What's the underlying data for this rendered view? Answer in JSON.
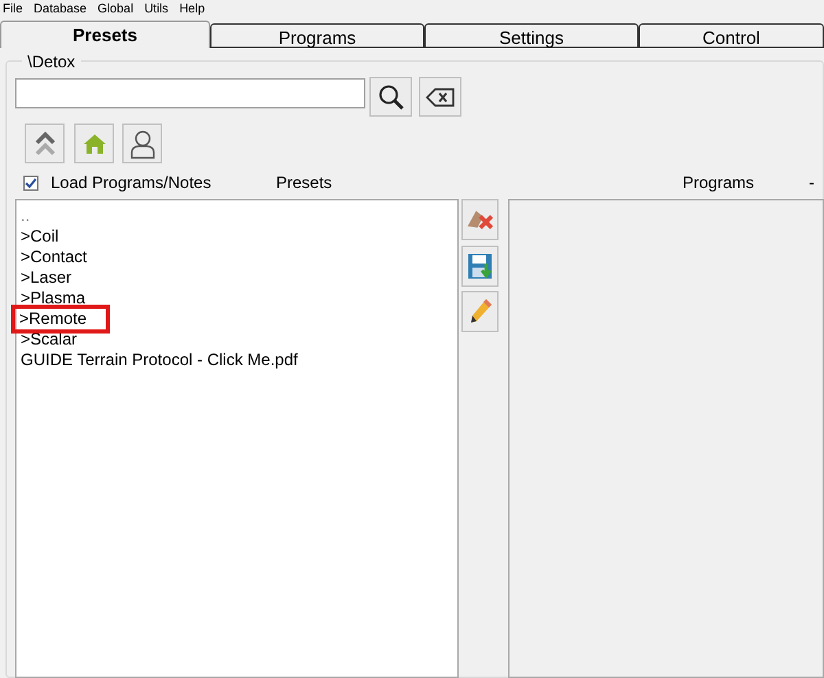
{
  "menu": [
    "File",
    "Database",
    "Global",
    "Utils",
    "Help"
  ],
  "tabs": [
    {
      "label": "Presets",
      "selected": true
    },
    {
      "label": "Programs",
      "selected": false
    },
    {
      "label": "Settings",
      "selected": false
    },
    {
      "label": "Control",
      "selected": false
    }
  ],
  "group_title": "\\Detox",
  "load_programs": {
    "label": "Load Programs/Notes",
    "checked": true
  },
  "presets_label": "Presets",
  "programs_label": "Programs",
  "programs_dash": "-",
  "presets_list": [
    {
      "text": "..",
      "highlighted": false
    },
    {
      "text": ">Coil",
      "highlighted": false
    },
    {
      "text": ">Contact",
      "highlighted": false
    },
    {
      "text": ">Laser",
      "highlighted": false
    },
    {
      "text": ">Plasma",
      "highlighted": false
    },
    {
      "text": ">Remote",
      "highlighted": true
    },
    {
      "text": ">Scalar",
      "highlighted": false
    },
    {
      "text": "GUIDE Terrain Protocol - Click Me.pdf",
      "highlighted": false
    }
  ]
}
